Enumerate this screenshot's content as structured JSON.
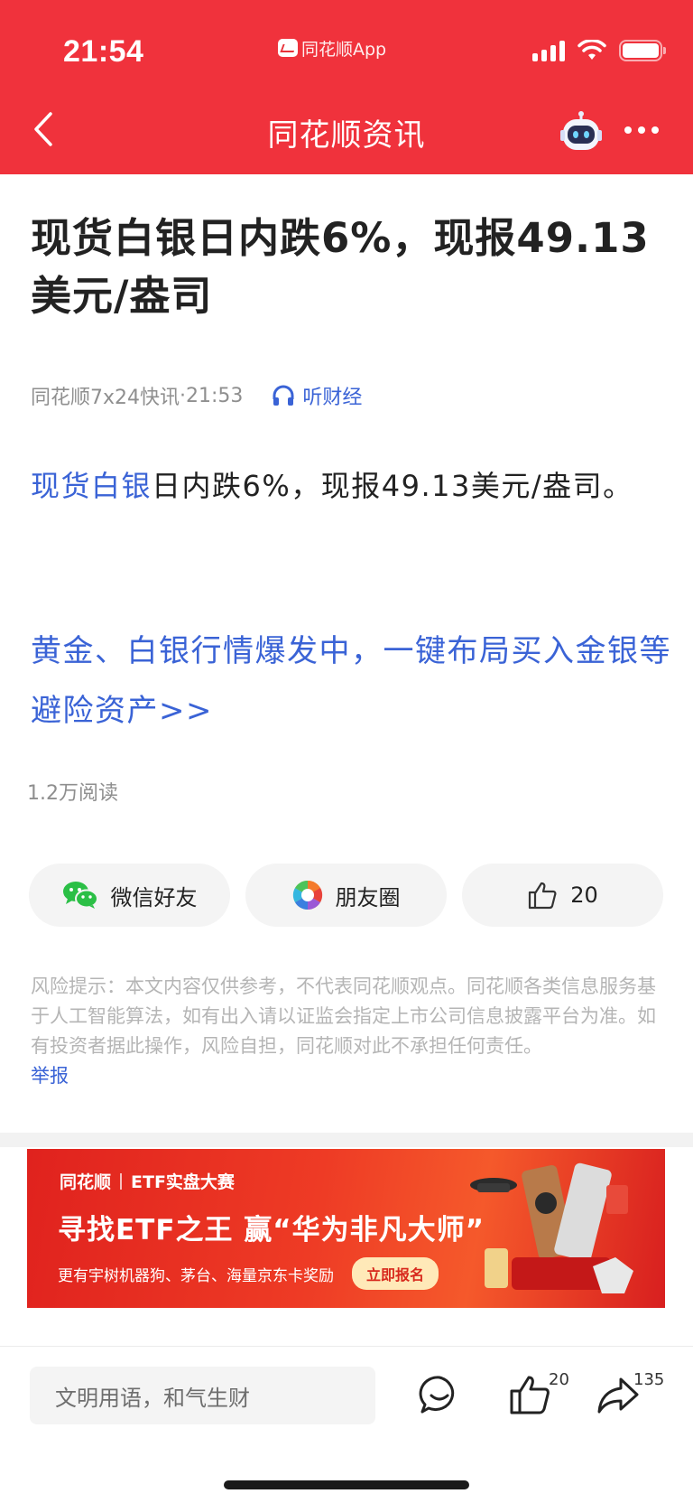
{
  "status_bar": {
    "time": "21:54",
    "app_label": "同花顺App"
  },
  "nav": {
    "title": "同花顺资讯"
  },
  "article": {
    "title": "现货白银日内跌6%，现报49.13美元/盎司",
    "source": "同花顺7x24快讯",
    "separator": "·",
    "time": "21:53",
    "listen_label": "听财经",
    "body_link": "现货白银",
    "body_rest": "日内跌6%，现报49.13美元/盎司。",
    "promo_link": "黄金、白银行情爆发中，一键布局买入金银等避险资产>>",
    "read_count": "1.2万阅读"
  },
  "share": {
    "wechat_label": "微信好友",
    "moments_label": "朋友圈",
    "like_count": "20"
  },
  "risk": {
    "text": "风险提示：本文内容仅供参考，不代表同花顺观点。同花顺各类信息服务基于人工智能算法，如有出入请以证监会指定上市公司信息披露平台为准。如有投资者据此操作，风险自担，同花顺对此不承担任何责任。",
    "report_label": "举报"
  },
  "banner": {
    "brand": "同花顺",
    "event": "ETF实盘大赛",
    "headline": "寻找ETF之王 赢“华为非凡大师”",
    "subline": "更有宇树机器狗、茅台、海量京东卡奖励",
    "button": "立即报名"
  },
  "bottom_bar": {
    "comment_placeholder": "文明用语，和气生财",
    "like_count": "20",
    "share_count": "135"
  },
  "colors": {
    "header_red": "#f0323c",
    "link_blue": "#3a63d6"
  }
}
